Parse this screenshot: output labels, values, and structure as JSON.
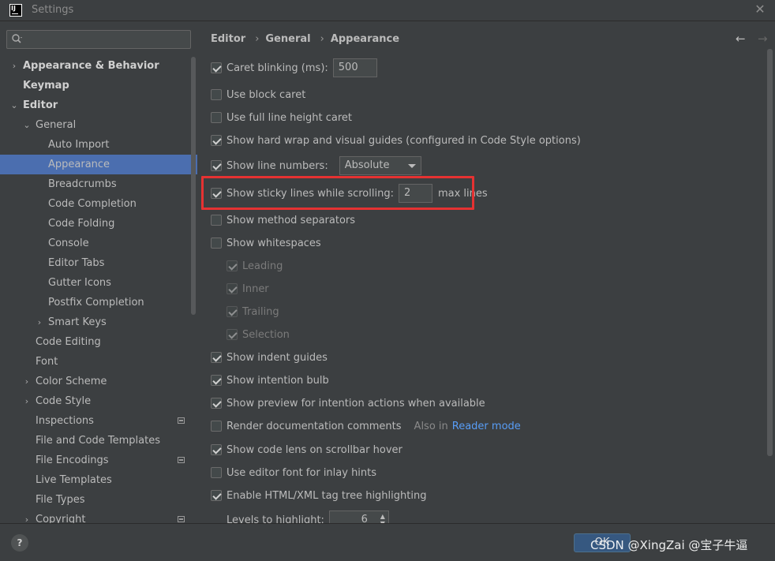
{
  "window": {
    "title": "Settings",
    "icon_text": "IJ"
  },
  "sidebar": {
    "search_placeholder": "",
    "items": [
      {
        "label": "Appearance & Behavior",
        "level": 0,
        "arrow": "›",
        "bold": true
      },
      {
        "label": "Keymap",
        "level": 0,
        "arrow": "",
        "bold": true
      },
      {
        "label": "Editor",
        "level": 0,
        "arrow": "⌄",
        "bold": true
      },
      {
        "label": "General",
        "level": 1,
        "arrow": "⌄"
      },
      {
        "label": "Auto Import",
        "level": 2,
        "arrow": ""
      },
      {
        "label": "Appearance",
        "level": 2,
        "arrow": "",
        "selected": true
      },
      {
        "label": "Breadcrumbs",
        "level": 2,
        "arrow": ""
      },
      {
        "label": "Code Completion",
        "level": 2,
        "arrow": ""
      },
      {
        "label": "Code Folding",
        "level": 2,
        "arrow": ""
      },
      {
        "label": "Console",
        "level": 2,
        "arrow": ""
      },
      {
        "label": "Editor Tabs",
        "level": 2,
        "arrow": ""
      },
      {
        "label": "Gutter Icons",
        "level": 2,
        "arrow": ""
      },
      {
        "label": "Postfix Completion",
        "level": 2,
        "arrow": ""
      },
      {
        "label": "Smart Keys",
        "level": 2,
        "arrow": "›"
      },
      {
        "label": "Code Editing",
        "level": 1,
        "arrow": ""
      },
      {
        "label": "Font",
        "level": 1,
        "arrow": ""
      },
      {
        "label": "Color Scheme",
        "level": 1,
        "arrow": "›"
      },
      {
        "label": "Code Style",
        "level": 1,
        "arrow": "›"
      },
      {
        "label": "Inspections",
        "level": 1,
        "arrow": "",
        "project": true
      },
      {
        "label": "File and Code Templates",
        "level": 1,
        "arrow": ""
      },
      {
        "label": "File Encodings",
        "level": 1,
        "arrow": "",
        "project": true
      },
      {
        "label": "Live Templates",
        "level": 1,
        "arrow": ""
      },
      {
        "label": "File Types",
        "level": 1,
        "arrow": ""
      },
      {
        "label": "Copyright",
        "level": 1,
        "arrow": "›",
        "project": true
      }
    ]
  },
  "breadcrumb": [
    "Editor",
    "General",
    "Appearance"
  ],
  "breadcrumb_sep": "›",
  "nav": {
    "back": "←",
    "forward": "→"
  },
  "options": {
    "caret_blinking": {
      "label": "Caret blinking (ms):",
      "checked": true,
      "value": "500"
    },
    "block_caret": {
      "label": "Use block caret",
      "checked": false
    },
    "full_line_caret": {
      "label": "Use full line height caret",
      "checked": false
    },
    "hard_wrap": {
      "label": "Show hard wrap and visual guides (configured in Code Style options)",
      "checked": true
    },
    "line_numbers": {
      "label": "Show line numbers:",
      "checked": true,
      "value": "Absolute"
    },
    "sticky_lines": {
      "label": "Show sticky lines while scrolling:",
      "checked": true,
      "value": "2",
      "suffix": "max lines"
    },
    "method_separators": {
      "label": "Show method separators",
      "checked": false
    },
    "whitespaces": {
      "label": "Show whitespaces",
      "checked": false
    },
    "leading": {
      "label": "Leading",
      "checked": true
    },
    "inner": {
      "label": "Inner",
      "checked": true
    },
    "trailing": {
      "label": "Trailing",
      "checked": true
    },
    "selection": {
      "label": "Selection",
      "checked": true
    },
    "indent_guides": {
      "label": "Show indent guides",
      "checked": true
    },
    "intention_bulb": {
      "label": "Show intention bulb",
      "checked": true
    },
    "preview_intention": {
      "label": "Show preview for intention actions when available",
      "checked": true
    },
    "render_docs": {
      "label": "Render documentation comments",
      "checked": false,
      "note": "Also in",
      "link": "Reader mode"
    },
    "code_lens": {
      "label": "Show code lens on scrollbar hover",
      "checked": true
    },
    "inlay_font": {
      "label": "Use editor font for inlay hints",
      "checked": false
    },
    "tag_tree": {
      "label": "Enable HTML/XML tag tree highlighting",
      "checked": true
    },
    "levels": {
      "label": "Levels to highlight:",
      "value": "6"
    }
  },
  "bottom": {
    "help": "?",
    "ok": "OK",
    "watermark": "CSDN @XingZai @宝子牛逼"
  },
  "colors": {
    "selection": "#4b6eaf",
    "highlight": "#e53232",
    "link": "#589df6",
    "background": "#3c3f41"
  }
}
